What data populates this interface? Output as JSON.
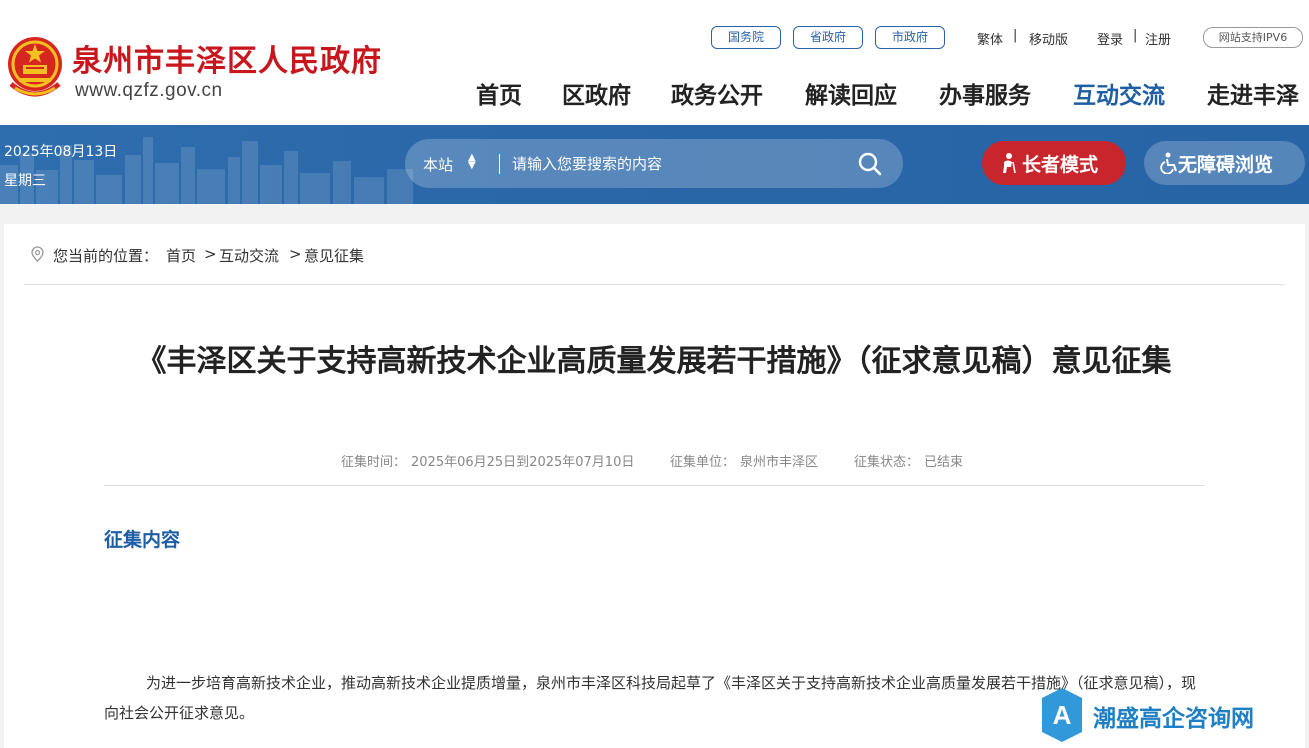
{
  "header": {
    "site_title": "泉州市丰泽区人民政府",
    "site_url": "www.qzfz.gov.cn",
    "gov_links": [
      "国务院",
      "省政府",
      "市政府"
    ],
    "top_links": {
      "traditional": "繁体",
      "mobile": "移动版",
      "login": "登录",
      "register": "注册",
      "separator": "|",
      "ipv6": "网站支持IPV6"
    },
    "nav": [
      "首页",
      "区政府",
      "政务公开",
      "解读回应",
      "办事服务",
      "互动交流",
      "走进丰泽"
    ],
    "active_nav": "互动交流"
  },
  "banner": {
    "date": "2025年08月13日",
    "weekday": "星期三",
    "search_scope": "本站",
    "search_placeholder": "请输入您要搜索的内容",
    "elder_mode": "长者模式",
    "accessible": "无障碍浏览"
  },
  "breadcrumb": {
    "prefix": "您当前的位置：",
    "items": [
      "首页",
      "互动交流",
      "意见征集"
    ],
    "separator": ">"
  },
  "article": {
    "title": "《丰泽区关于支持高新技术企业高质量发展若干措施》（征求意见稿）意见征集",
    "meta": {
      "time_label": "征集时间：",
      "time_value": "2025年06月25日到2025年07月10日",
      "unit_label": "征集单位：",
      "unit_value": "泉州市丰泽区",
      "status_label": "征集状态：",
      "status_value": "已结束"
    },
    "section_heading": "征集内容",
    "body": "为进一步培育高新技术企业，推动高新技术企业提质增量，泉州市丰泽区科技局起草了《丰泽区关于支持高新技术企业高质量发展若干措施》（征求意见稿），现向社会公开征求意见。"
  },
  "watermark": {
    "text": "潮盛高企咨询网",
    "logo_letter": "A"
  },
  "colors": {
    "brand_red": "#c8161d",
    "nav_active": "#1f5da5",
    "banner_blue": "#2a67a8",
    "elder_red": "#c8262c"
  }
}
